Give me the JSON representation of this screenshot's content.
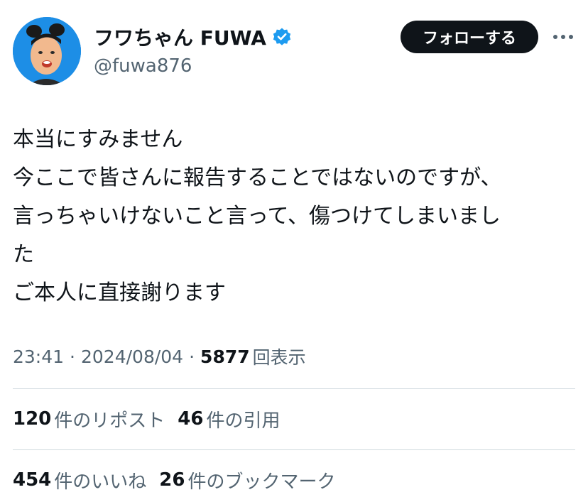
{
  "colors": {
    "text_primary": "#0f1419",
    "text_secondary": "#536471",
    "avatar_bg": "#1d8ee6",
    "verified_blue": "#1d9bf0",
    "button_bg": "#0f1419",
    "divider": "#cfd9de"
  },
  "author": {
    "display_name": "フワちゃん FUWA",
    "handle": "@fuwa876",
    "verified_icon": "verified-badge-icon",
    "avatar_icon": "avatar-photo"
  },
  "header": {
    "follow_label": "フォローする",
    "more_icon": "more-horizontal-icon"
  },
  "tweet": {
    "lines": [
      "本当にすみません",
      "今ここで皆さんに報告することではないのですが、",
      "言っちゃいけないこと言って、傷つけてしまいまし",
      "た",
      "ご本人に直接謝ります"
    ]
  },
  "meta": {
    "time": "23:41",
    "separator": "·",
    "date": "2024/08/04",
    "views_count": "5877",
    "views_label": "回表示"
  },
  "stats": {
    "reposts_count": "120",
    "reposts_label": "件のリポスト",
    "quotes_count": "46",
    "quotes_label": "件の引用",
    "likes_count": "454",
    "likes_label": "件のいいね",
    "bookmarks_count": "26",
    "bookmarks_label": "件のブックマーク"
  }
}
